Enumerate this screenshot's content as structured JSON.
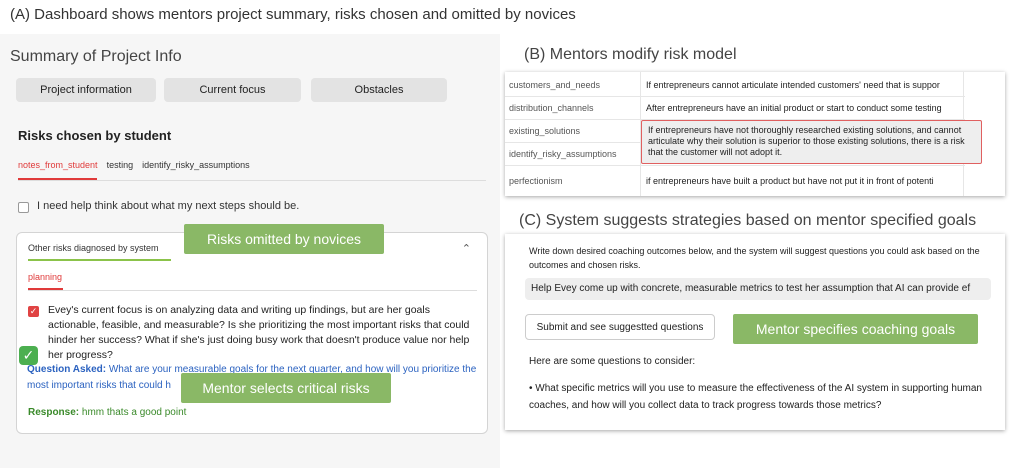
{
  "caption_a": "(A) Dashboard shows mentors project summary,  risks chosen and omitted by novices",
  "panel_a": {
    "title": "Summary of Project Info",
    "pills": [
      "Project information",
      "Current focus",
      "Obstacles"
    ],
    "risks_heading": "Risks chosen by student",
    "tabs": [
      "notes_from_student",
      "testing",
      "identify_risky_assumptions"
    ],
    "checkbox_label": "I need help think about what my next steps should be.",
    "diagnosed_title": "Other risks diagnosed by system",
    "planning_tab": "planning",
    "diagnosis_text": "Evey's current focus is on analyzing data and writing up findings, but are her goals actionable, feasible, and measurable? Is she prioritizing the most important risks that could hinder her success? What if she's just doing busy work that doesn't produce value nor help her progress?",
    "question_label": "Question Asked:",
    "question_text": " What are your measurable goals for the next quarter, and how will you prioritize the most important risks that could h",
    "response_label": "Response:",
    "response_text": " hmm thats a good point",
    "tag_omitted": "Risks omitted by novices",
    "tag_selects": "Mentor selects critical risks"
  },
  "panel_b": {
    "title": "(B) Mentors modify risk model",
    "rows": [
      {
        "name": "customers_and_needs",
        "desc": "If entrepreneurs cannot articulate intended customers' need that is suppor"
      },
      {
        "name": "distribution_channels",
        "desc": "After entrepreneurs have an initial product or start to conduct some testing"
      },
      {
        "name": "existing_solutions",
        "desc": ""
      },
      {
        "name": "identify_risky_assumptions",
        "desc": ""
      },
      {
        "name": "perfectionism",
        "desc": "if entrepreneurs have built a product but have not put it in front of potenti"
      }
    ],
    "edit_text": "If entrepreneurs have not thoroughly researched existing solutions, and cannot articulate why their solution is superior to those existing solutions, there is a risk that the customer will not adopt it."
  },
  "panel_c": {
    "title": "(C) System suggests strategies based on mentor specified goals",
    "intro": "Write down desired coaching outcomes below, and the system will suggest questions you could ask based on the outcomes and chosen risks.",
    "goal_value": "Help Evey come up with concrete, measurable metrics to test her assumption that AI can provide ef",
    "submit_label": "Submit and see suggestted questions",
    "tag_coaching": "Mentor specifies coaching goals",
    "consider_label": "Here are some questions to consider:",
    "bullet_question": "• What specific metrics will you use to measure the effectiveness of the AI system in supporting human coaches, and how will you collect data to track progress towards those metrics?"
  },
  "colors": {
    "accent_red": "#e03a3a",
    "tag_green": "#8ab866",
    "question_blue": "#2b62c0",
    "response_green": "#3a8a2a"
  }
}
